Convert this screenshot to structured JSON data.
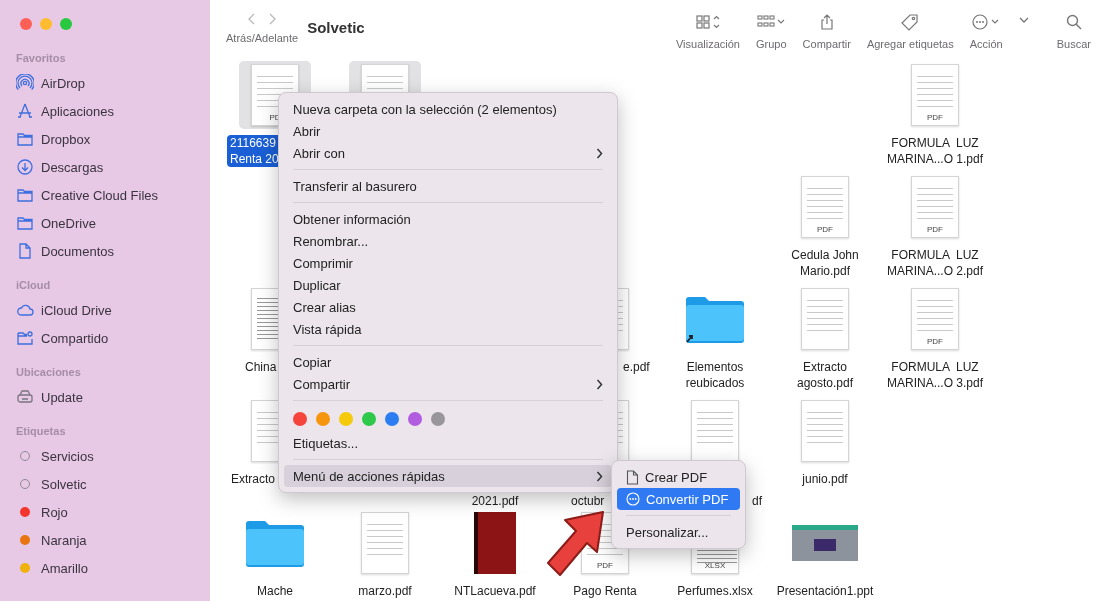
{
  "window": {
    "title": "Solvetic"
  },
  "toolbar": {
    "nav_label": "Atrás/Adelante",
    "buttons": [
      {
        "kind": "view",
        "label": "Visualización"
      },
      {
        "kind": "group",
        "label": "Grupo"
      },
      {
        "kind": "share",
        "label": "Compartir"
      },
      {
        "kind": "tag",
        "label": "Agregar etiquetas"
      },
      {
        "kind": "action",
        "label": "Acción"
      },
      {
        "kind": "search",
        "label": "Buscar"
      }
    ]
  },
  "sidebar": {
    "sections": [
      {
        "title": "Favoritos",
        "items": [
          {
            "label": "AirDrop",
            "kind": "airdrop"
          },
          {
            "label": "Aplicaciones",
            "kind": "apps"
          },
          {
            "label": "Dropbox",
            "kind": "folder"
          },
          {
            "label": "Descargas",
            "kind": "download"
          },
          {
            "label": "Creative Cloud Files",
            "kind": "folder"
          },
          {
            "label": "OneDrive",
            "kind": "folder"
          },
          {
            "label": "Documentos",
            "kind": "doc"
          }
        ]
      },
      {
        "title": "iCloud",
        "items": [
          {
            "label": "iCloud Drive",
            "kind": "cloud"
          },
          {
            "label": "Compartido",
            "kind": "shared"
          }
        ]
      },
      {
        "title": "Ubicaciones",
        "items": [
          {
            "label": "Update",
            "kind": "drive"
          }
        ]
      },
      {
        "title": "Etiquetas",
        "items": [
          {
            "label": "Servicios",
            "kind": "ring",
            "color": "#8e8a92"
          },
          {
            "label": "Solvetic",
            "kind": "ring",
            "color": "#8e8a92"
          },
          {
            "label": "Rojo",
            "kind": "dot",
            "color": "#f2362e"
          },
          {
            "label": "Naranja",
            "kind": "dot",
            "color": "#e8750f"
          },
          {
            "label": "Amarillo",
            "kind": "dot",
            "color": "#efb20c"
          }
        ]
      }
    ]
  },
  "files": [
    {
      "kind": "doc",
      "selected": true,
      "lines": [
        "2116639",
        "Renta 20"
      ],
      "badge": "PD"
    },
    {
      "kind": "doc",
      "selected": true
    },
    {
      "kind": "doc",
      "selected": false,
      "lines": [
        "FORMULA  LUZ",
        "MARINA...O 1.pdf"
      ],
      "badge": "PDF"
    },
    {
      "kind": "doc",
      "selected": false,
      "lines": [
        "Cedula John",
        "Mario.pdf"
      ],
      "badge": "PDF"
    },
    {
      "kind": "doc",
      "selected": false,
      "lines": [
        "FORMULA  LUZ",
        "MARINA...O 2.pdf"
      ],
      "badge": "PDF"
    },
    {
      "kind": "sheet",
      "selected": false,
      "lines": [
        "China"
      ]
    },
    {
      "kind": "doc",
      "selected": false,
      "lines": [
        "e.pdf"
      ]
    },
    {
      "kind": "alias",
      "selected": false,
      "lines": [
        "Elementos",
        "reubicados"
      ]
    },
    {
      "kind": "doc",
      "selected": false,
      "lines": [
        "Extracto",
        "agosto.pdf"
      ]
    },
    {
      "kind": "doc",
      "selected": false,
      "lines": [
        "FORMULA  LUZ",
        "MARINA...O 3.pdf"
      ],
      "badge": "PDF"
    },
    {
      "kind": "doc",
      "selected": false,
      "lines": [
        "Extracto"
      ]
    },
    {
      "kind": "doc",
      "selected": false,
      "lines": [
        "2021.pdf"
      ]
    },
    {
      "kind": "doc",
      "selected": false,
      "lines": [
        "octubr"
      ]
    },
    {
      "kind": "doc",
      "selected": false,
      "lines": [
        "df"
      ]
    },
    {
      "kind": "doc",
      "selected": false,
      "lines": [
        "junio.pdf"
      ]
    },
    {
      "kind": "folder",
      "selected": false,
      "lines": [
        "Mache"
      ]
    },
    {
      "kind": "doc",
      "selected": false,
      "lines": [
        "marzo.pdf"
      ]
    },
    {
      "kind": "cover",
      "selected": false,
      "lines": [
        "NTLacueva.pdf"
      ]
    },
    {
      "kind": "doc",
      "selected": false,
      "lines": [
        "Pago Renta"
      ],
      "badge": "PDF"
    },
    {
      "kind": "sheet",
      "selected": false,
      "lines": [
        "Perfumes.xlsx"
      ],
      "badge": "XLSX"
    },
    {
      "kind": "slide",
      "selected": false,
      "lines": [
        "Presentación1.ppt"
      ]
    }
  ],
  "context_menu": {
    "items": [
      {
        "kind": "item",
        "label": "Nueva carpeta con la selección (2 elementos)",
        "submenu": false,
        "selected": false
      },
      {
        "kind": "item",
        "label": "Abrir",
        "submenu": false,
        "selected": false
      },
      {
        "kind": "item",
        "label": "Abrir con",
        "submenu": true,
        "selected": false
      },
      {
        "kind": "separator"
      },
      {
        "kind": "item",
        "label": "Transferir al basurero",
        "submenu": false,
        "selected": false
      },
      {
        "kind": "separator"
      },
      {
        "kind": "item",
        "label": "Obtener información",
        "submenu": false,
        "selected": false
      },
      {
        "kind": "item",
        "label": "Renombrar...",
        "submenu": false,
        "selected": false
      },
      {
        "kind": "item",
        "label": "Comprimir",
        "submenu": false,
        "selected": false
      },
      {
        "kind": "item",
        "label": "Duplicar",
        "submenu": false,
        "selected": false
      },
      {
        "kind": "item",
        "label": "Crear alias",
        "submenu": false,
        "selected": false
      },
      {
        "kind": "item",
        "label": "Vista rápida",
        "submenu": false,
        "selected": false
      },
      {
        "kind": "separator"
      },
      {
        "kind": "item",
        "label": "Copiar",
        "submenu": false,
        "selected": false
      },
      {
        "kind": "item",
        "label": "Compartir",
        "submenu": true,
        "selected": false
      },
      {
        "kind": "separator"
      },
      {
        "kind": "colors",
        "colors": [
          {
            "color": "#f4443c"
          },
          {
            "color": "#f6960f"
          },
          {
            "color": "#f6ca0c"
          },
          {
            "color": "#2ec94a"
          },
          {
            "color": "#2c7cf2"
          },
          {
            "color": "#b25ce0"
          },
          {
            "color": "#98969b"
          }
        ]
      },
      {
        "kind": "item",
        "label": "Etiquetas...",
        "submenu": false,
        "selected": false
      },
      {
        "kind": "separator"
      },
      {
        "kind": "item",
        "label": "Menú de acciones rápidas",
        "submenu": true,
        "selected": true
      }
    ]
  },
  "quick_actions_menu": {
    "items": [
      {
        "kind": "doc_item",
        "label": "Crear PDF",
        "submenu": false,
        "selected": false
      },
      {
        "kind": "action_item",
        "label": "Convertir PDF",
        "submenu": false,
        "selected": true
      },
      {
        "kind": "separator"
      },
      {
        "kind": "item",
        "label": "Personalizar...",
        "submenu": false,
        "selected": false
      }
    ]
  }
}
